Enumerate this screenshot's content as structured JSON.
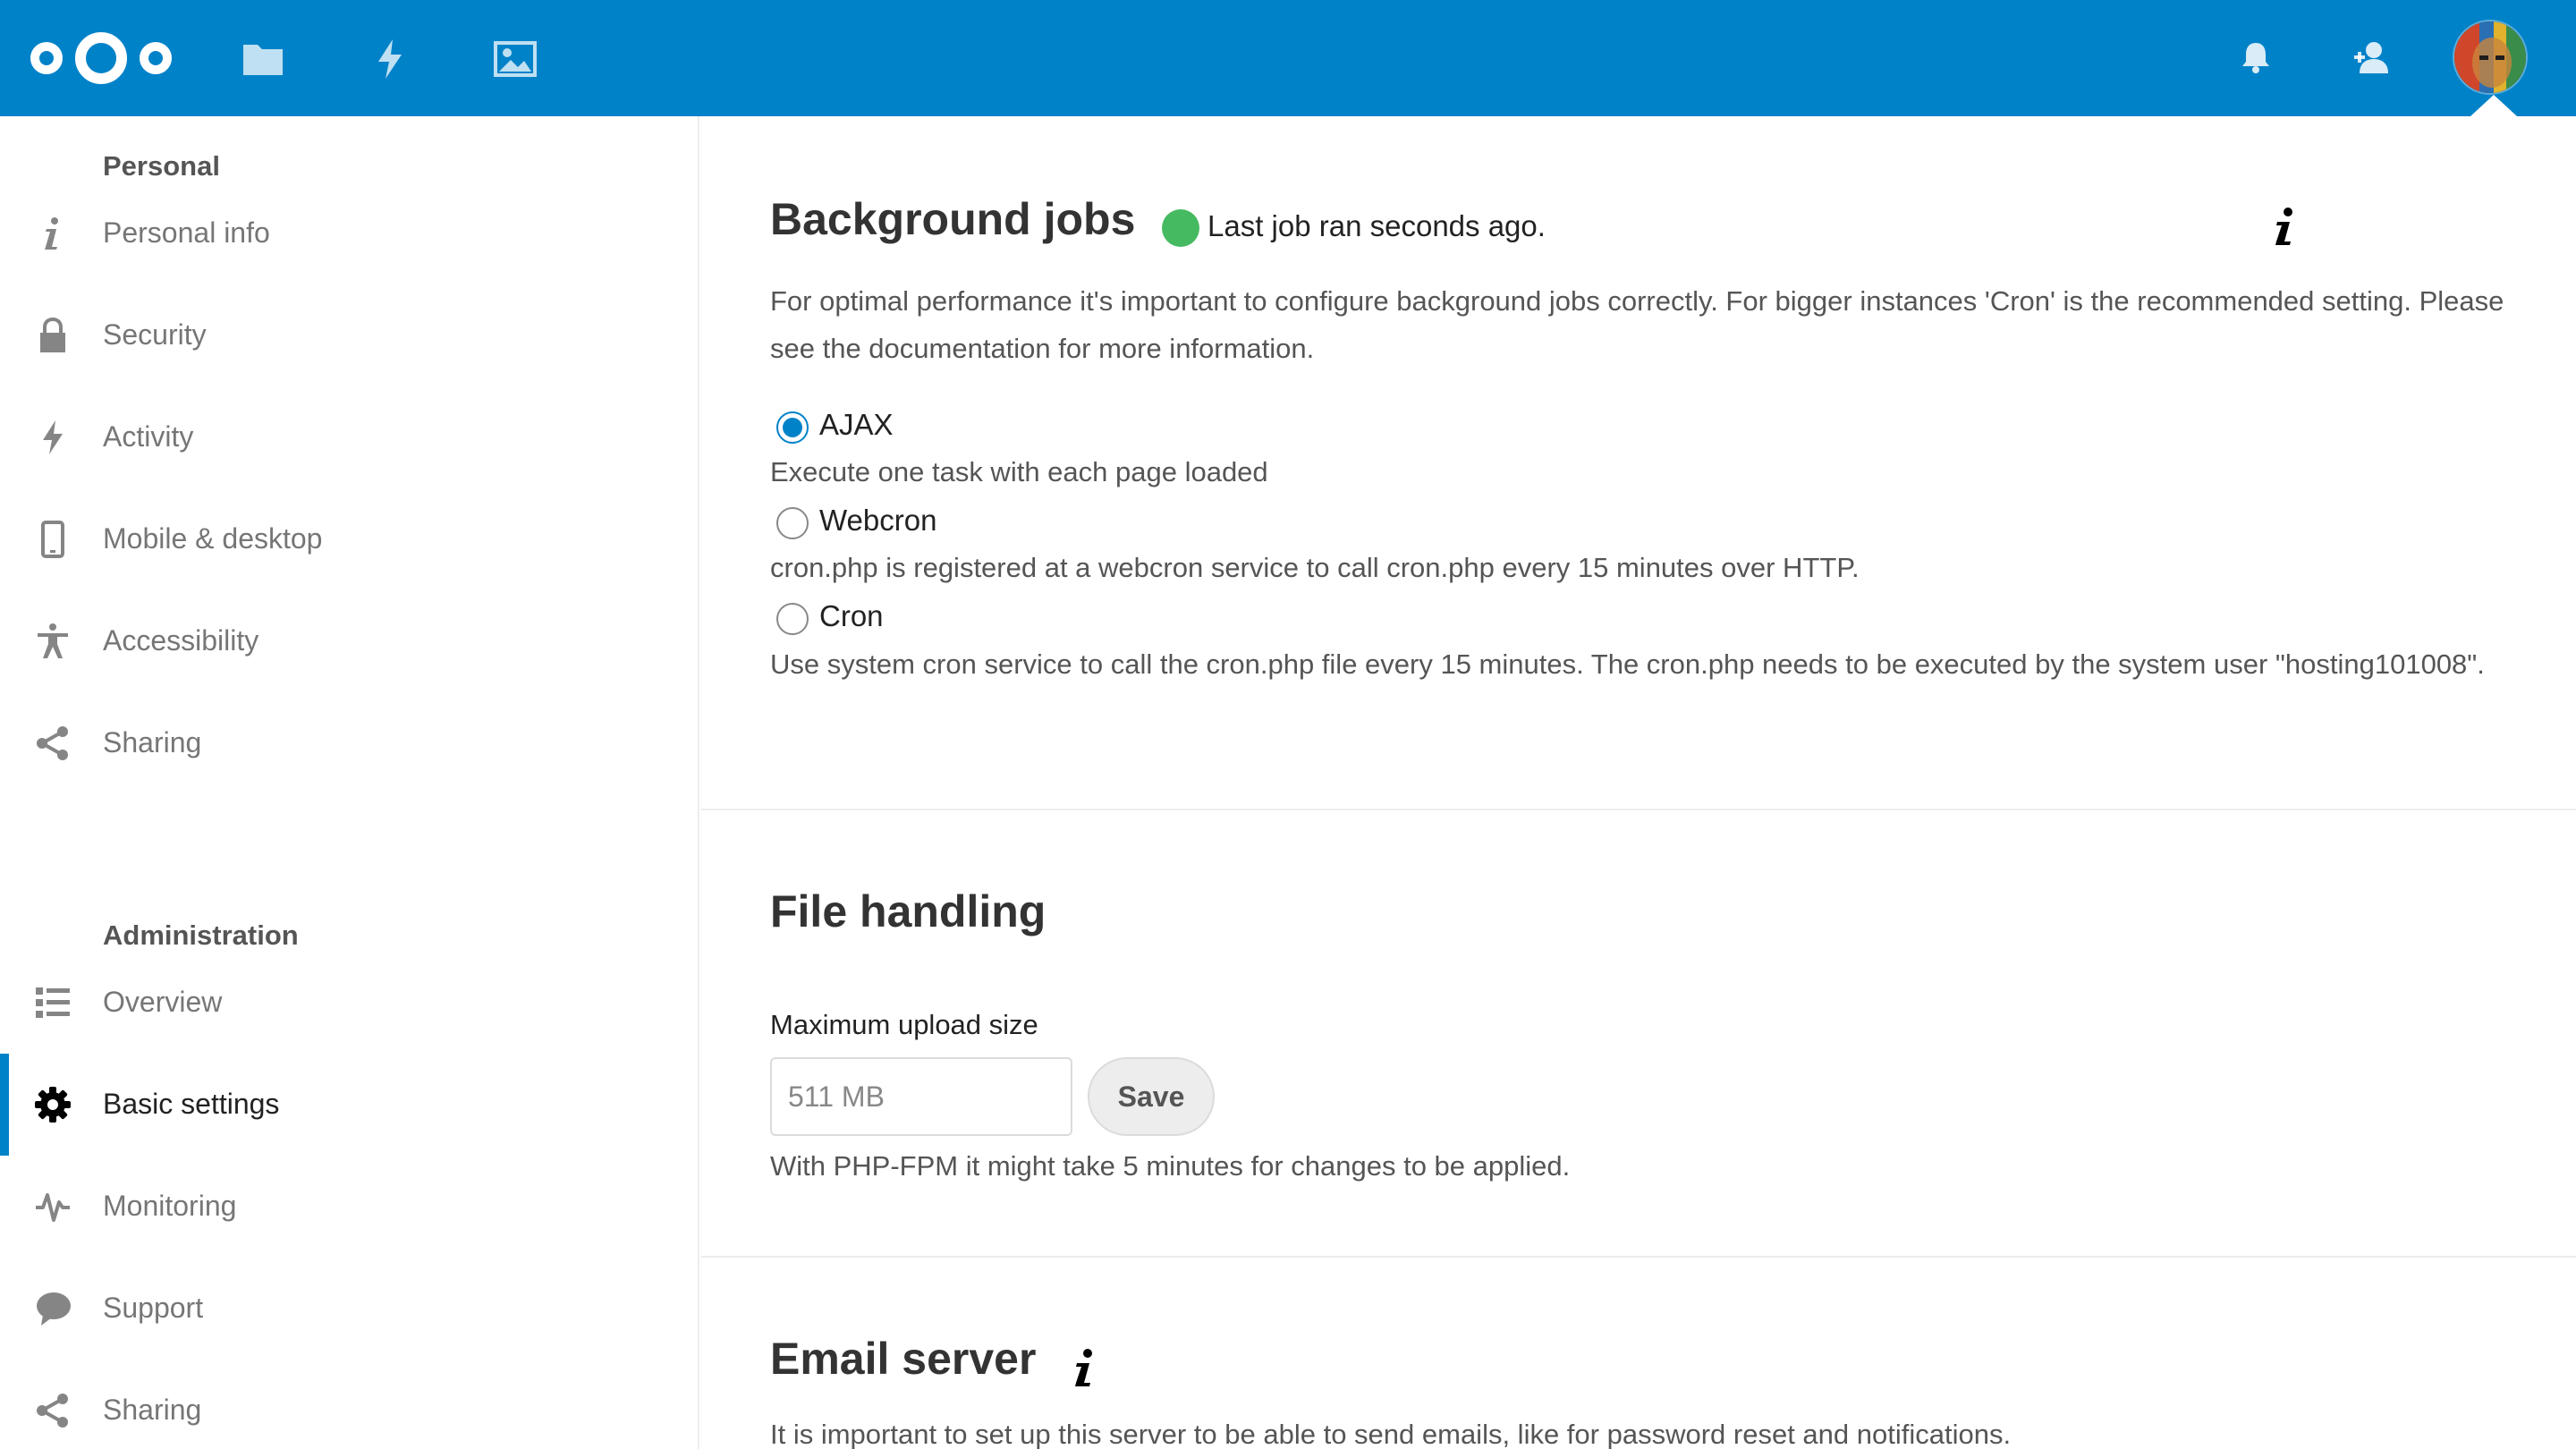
{
  "header": {
    "apps": [
      {
        "name": "files-app",
        "icon": "folder-icon"
      },
      {
        "name": "activity-app",
        "icon": "lightning-icon"
      },
      {
        "name": "photos-app",
        "icon": "image-icon"
      }
    ],
    "right": [
      {
        "name": "notifications",
        "icon": "bell-icon"
      },
      {
        "name": "contacts",
        "icon": "contacts-icon"
      }
    ],
    "brand_color": "#0082c9"
  },
  "sidebar": {
    "personal_caption": "Personal",
    "personal_items": [
      {
        "label": "Personal info",
        "icon": "info-icon"
      },
      {
        "label": "Security",
        "icon": "lock-icon"
      },
      {
        "label": "Activity",
        "icon": "lightning-icon"
      },
      {
        "label": "Mobile & desktop",
        "icon": "phone-icon"
      },
      {
        "label": "Accessibility",
        "icon": "accessibility-icon"
      },
      {
        "label": "Sharing",
        "icon": "share-icon"
      }
    ],
    "admin_caption": "Administration",
    "admin_items": [
      {
        "label": "Overview",
        "icon": "list-icon"
      },
      {
        "label": "Basic settings",
        "icon": "gear-icon",
        "active": true
      },
      {
        "label": "Monitoring",
        "icon": "pulse-icon"
      },
      {
        "label": "Support",
        "icon": "speech-bubble-icon"
      },
      {
        "label": "Sharing",
        "icon": "share-icon"
      }
    ]
  },
  "background_jobs": {
    "title": "Background jobs",
    "status": "Last job ran seconds ago.",
    "status_color": "#46ba61",
    "description": "For optimal performance it's important to configure background jobs correctly. For bigger instances 'Cron' is the recommended setting. Please see the documentation for more information.",
    "options": [
      {
        "label": "AJAX",
        "description": "Execute one task with each page loaded",
        "checked": true
      },
      {
        "label": "Webcron",
        "description": "cron.php is registered at a webcron service to call cron.php every 15 minutes over HTTP.",
        "checked": false
      },
      {
        "label": "Cron",
        "description": "Use system cron service to call the cron.php file every 15 minutes. The cron.php needs to be executed by the system user \"hosting101008\".",
        "checked": false
      }
    ]
  },
  "file_handling": {
    "title": "File handling",
    "max_upload_label": "Maximum upload size",
    "max_upload_value": "511 MB",
    "save_label": "Save",
    "hint": "With PHP-FPM it might take 5 minutes for changes to be applied."
  },
  "email_server": {
    "title": "Email server",
    "description": "It is important to set up this server to be able to send emails, like for password reset and notifications."
  }
}
